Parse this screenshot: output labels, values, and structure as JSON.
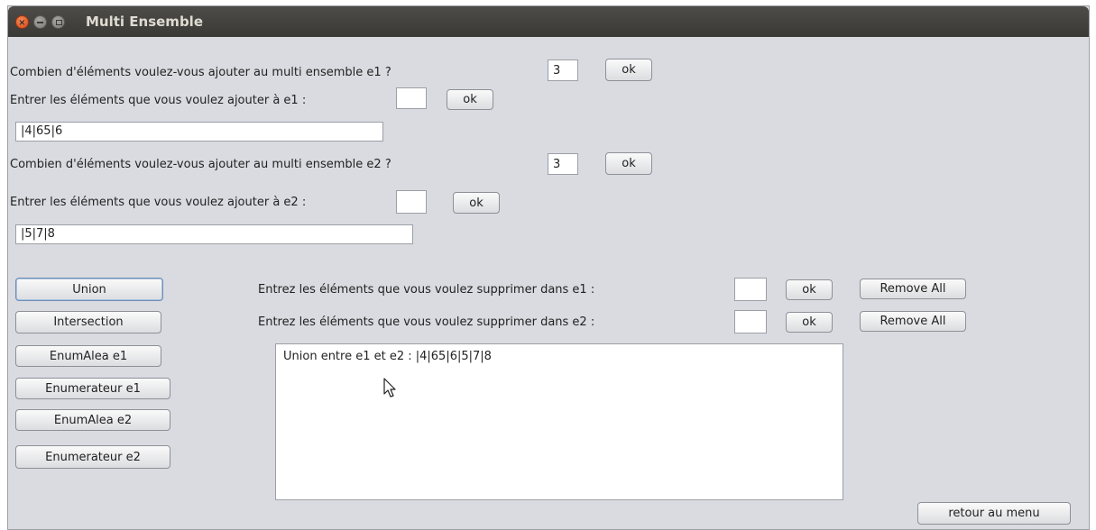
{
  "window": {
    "title": "Multi Ensemble"
  },
  "e1": {
    "count_label": "Combien d'éléments voulez-vous ajouter au multi ensemble e1 ?",
    "count_value": "3",
    "count_ok": "ok",
    "elements_label": "Entrer les éléments que vous voulez ajouter à e1 :",
    "elements_value": "",
    "elements_ok": "ok",
    "result": "|4|65|6"
  },
  "e2": {
    "count_label": "Combien d'éléments voulez-vous ajouter au multi ensemble e2 ?",
    "count_value": "3",
    "count_ok": "ok",
    "elements_label": "Entrer les éléments que vous voulez ajouter à e2 :",
    "elements_value": "",
    "elements_ok": "ok",
    "result": "|5|7|8"
  },
  "operations": {
    "union": "Union",
    "intersection": "Intersection",
    "enumalea_e1": "EnumAlea e1",
    "enumerateur_e1": "Enumerateur e1",
    "enumalea_e2": "EnumAlea e2",
    "enumerateur_e2": "Enumerateur e2"
  },
  "remove": {
    "e1_label": "Entrez les éléments que vous voulez supprimer dans e1 :",
    "e1_value": "",
    "e1_ok": "ok",
    "e1_remove_all": "Remove All",
    "e2_label": "Entrez les éléments que vous voulez supprimer dans e2 :",
    "e2_value": "",
    "e2_ok": "ok",
    "e2_remove_all": "Remove All"
  },
  "output": {
    "text": "Union entre e1 et e2 : |4|65|6|5|7|8"
  },
  "footer": {
    "back_button": "retour au menu"
  }
}
